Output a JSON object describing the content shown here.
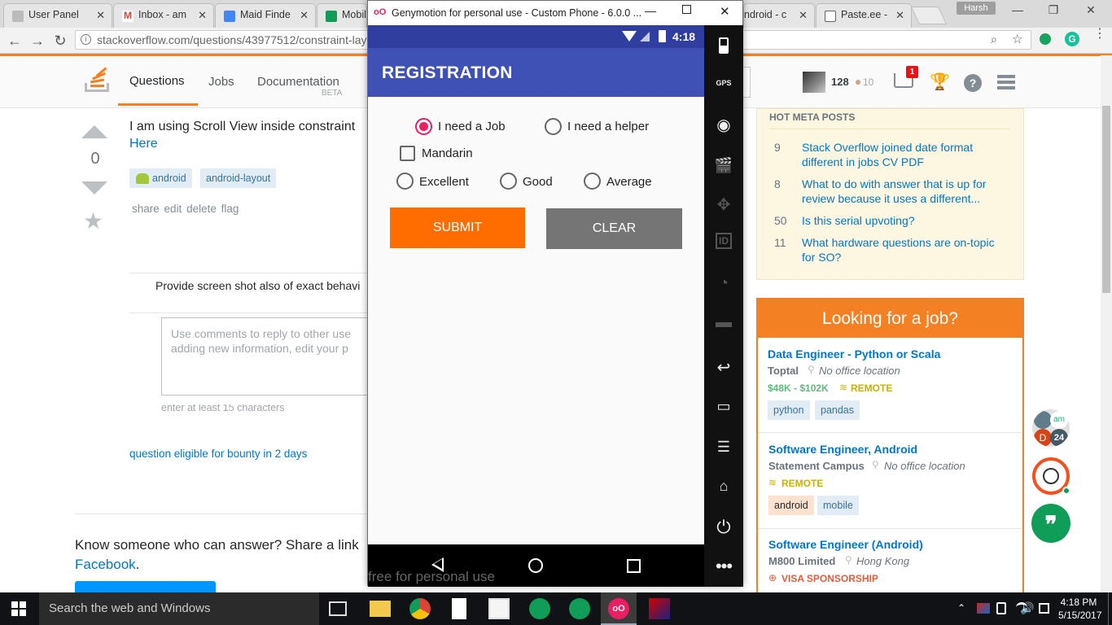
{
  "chrome": {
    "tabs": [
      {
        "title": "User Panel"
      },
      {
        "title": "Inbox - am"
      },
      {
        "title": "Maid Finde"
      },
      {
        "title": "Mobile"
      },
      {
        "title": "ndroid - c"
      },
      {
        "title": "Paste.ee -"
      }
    ],
    "profile": "Harsh",
    "url": "stackoverflow.com/questions/43977512/constraint-lay"
  },
  "so": {
    "nav": {
      "questions": "Questions",
      "jobs": "Jobs",
      "documentation": "Documentation",
      "beta": "BETA"
    },
    "user": {
      "rep": "128",
      "bronze": "10",
      "inbox_badge": "1"
    },
    "question": {
      "votes": "0",
      "text_line1": "I am using Scroll View inside constraint",
      "text_link": "Here",
      "tags": [
        "android",
        "android-layout"
      ],
      "actions": [
        "share",
        "edit",
        "delete",
        "flag"
      ],
      "comment": "Provide screen shot also of exact behavi",
      "comment_placeholder_1": "Use comments to reply to other use",
      "comment_placeholder_2": "adding new information, edit your p",
      "comment_hint": "enter at least 15 characters",
      "bounty": "question eligible for bounty in 2 days",
      "share_text": "Know someone who can answer? Share a link",
      "facebook": "Facebook",
      "period": "."
    },
    "meta": {
      "title": "HOT META POSTS",
      "posts": [
        {
          "num": "9",
          "line1": "Stack Overflow joined date format",
          "line2": "different in jobs CV PDF"
        },
        {
          "num": "8",
          "line1": "What to do with answer that is up for",
          "line2": "review because it uses a different..."
        },
        {
          "num": "50",
          "line1": "Is this serial upvoting?",
          "line2": ""
        },
        {
          "num": "11",
          "line1": "What hardware questions are on-topic",
          "line2": "for SO?"
        }
      ]
    },
    "jobs": {
      "title": "Looking for a job?",
      "items": [
        {
          "title": "Data Engineer - Python or Scala",
          "company": "Toptal",
          "location": "No office location",
          "salary": "$48K - $102K",
          "perk": "REMOTE",
          "tags": [
            "python",
            "pandas"
          ]
        },
        {
          "title": "Software Engineer, Android",
          "company": "Statement Campus",
          "location": "No office location",
          "salary": "",
          "perk": "REMOTE",
          "tags": [
            "android",
            "mobile"
          ]
        },
        {
          "title": "Software Engineer (Android)",
          "company": "M800 Limited",
          "location": "Hong Kong",
          "salary": "",
          "perk": "VISA SPONSORSHIP",
          "tags": []
        }
      ]
    }
  },
  "geny": {
    "title": "Genymotion for personal use - Custom Phone - 6.0.0 ...",
    "time": "4:18",
    "app_title": "REGISTRATION",
    "radio_job": "I need a Job",
    "radio_helper": "I need a helper",
    "checkbox": "Mandarin",
    "rating": [
      "Excellent",
      "Good",
      "Average"
    ],
    "submit": "SUBMIT",
    "clear": "CLEAR",
    "watermark": "free for personal use",
    "gps": "GPS"
  },
  "taskbar": {
    "search": "Search the web and Windows",
    "time": "4:18 PM",
    "date": "5/15/2017"
  },
  "chat": {
    "count": "24",
    "initial": "D"
  },
  "colors": {
    "so_orange": "#f48024",
    "so_blue": "#0077cc",
    "indigo": "#3f51b5",
    "pink": "#e91e63",
    "submit": "#ff6d00",
    "clear": "#757575"
  }
}
